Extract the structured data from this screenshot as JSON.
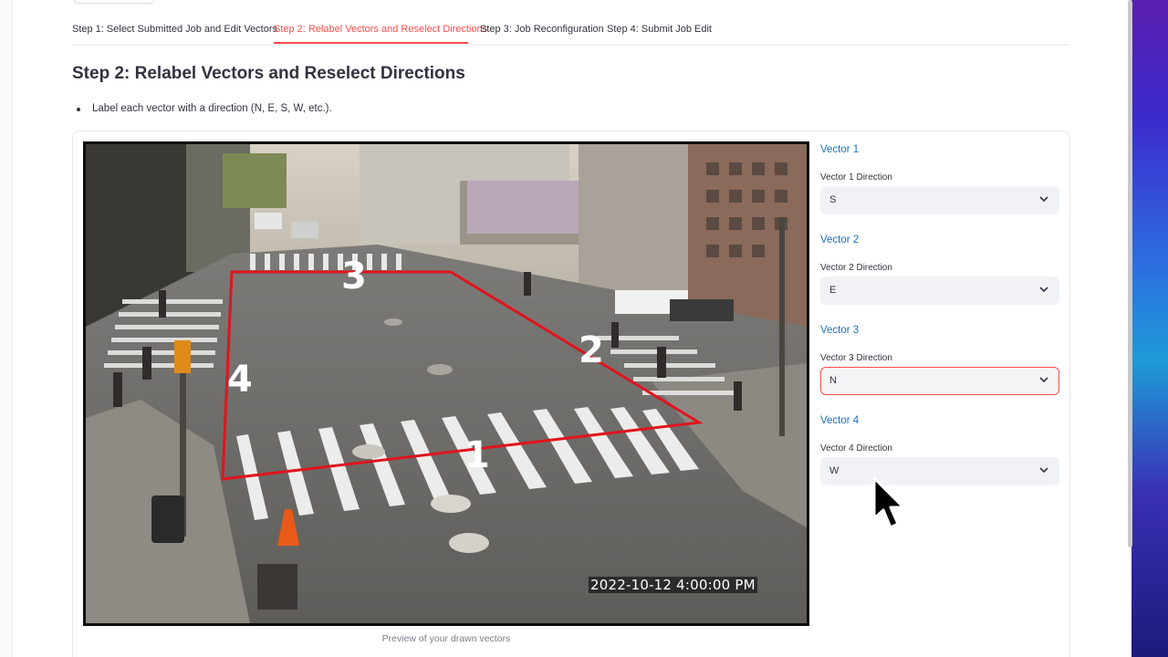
{
  "tabs": [
    {
      "label": "Step 1: Select Submitted Job and Edit Vectors",
      "active": false
    },
    {
      "label": "Step 2: Relabel Vectors and Reselect Directions",
      "active": true
    },
    {
      "label": "Step 3: Job Reconfiguration",
      "active": false
    },
    {
      "label": "Step 4: Submit Job Edit",
      "active": false
    }
  ],
  "page": {
    "title": "Step 2: Relabel Vectors and Reselect Directions",
    "instruction": "Label each vector with a direction (N, E, S, W, etc.)."
  },
  "preview": {
    "timestamp": "2022-10-12 4:00:00 PM",
    "caption": "Preview of your drawn vectors",
    "vector_labels": [
      "1",
      "2",
      "3",
      "4"
    ]
  },
  "vectors": [
    {
      "heading": "Vector 1",
      "label": "Vector 1 Direction",
      "value": "S"
    },
    {
      "heading": "Vector 2",
      "label": "Vector 2 Direction",
      "value": "E"
    },
    {
      "heading": "Vector 3",
      "label": "Vector 3 Direction",
      "value": "N"
    },
    {
      "heading": "Vector 4",
      "label": "Vector 4 Direction",
      "value": "W"
    }
  ],
  "colors": {
    "accent": "#ff4b4b",
    "vector_heading": "#1f6fbf",
    "polygon": "#e0141e"
  },
  "icons": [
    "chevron-down-icon",
    "mouse-pointer-icon"
  ]
}
